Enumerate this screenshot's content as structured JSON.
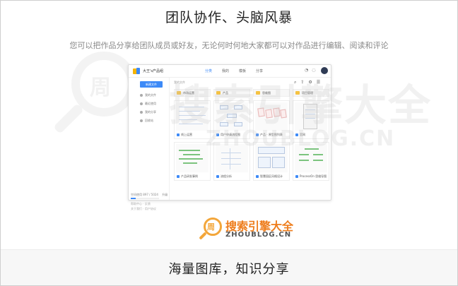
{
  "headline": "团队协作、头脑风暴",
  "subline": "您可以把作品分享给团队成员或好友，无论何时何地大家都可以对作品进行编辑、阅读和评论",
  "footer_title": "海量图库，知识分享",
  "watermark": {
    "circle_char": "周",
    "text": "搜索引擎大全",
    "sub": "ZHOUBLOG.CN"
  },
  "logo": {
    "circle_char": "周",
    "text": "搜索引擎大全",
    "sub": "ZHOUBLOG.CN",
    "color": "#ee7d1c"
  },
  "app": {
    "brand": "大王's产品组",
    "tabs": [
      {
        "label": "分类",
        "active": true
      },
      {
        "label": "我的",
        "active": false
      },
      {
        "label": "模板",
        "active": false
      },
      {
        "label": "分享",
        "active": false
      }
    ],
    "sidebar": {
      "new_button": "新建文件",
      "items": [
        {
          "label": "我的文件"
        },
        {
          "label": "最近使用"
        },
        {
          "label": "我的分享"
        },
        {
          "label": "回收站"
        }
      ],
      "storage": "空间使用 897 / 5024",
      "storage_unit": "升级",
      "storage_fraction": 0.18,
      "foot1": "帮助中心 · 反馈",
      "foot2": "关于我们 · 用户协议"
    },
    "breadcrumb": "我的文件",
    "folders": [
      {
        "label": "市场运营"
      },
      {
        "label": "产品"
      },
      {
        "label": "思维图"
      },
      {
        "label": "项目管理"
      }
    ],
    "cards": [
      {
        "label": "线上运营"
      },
      {
        "label": "用户申请流程图"
      },
      {
        "label": "产品 · 原型图列表"
      },
      {
        "label": "官网"
      },
      {
        "label": "产品研发事例"
      },
      {
        "label": "流程分析"
      },
      {
        "label": "智慧园区风格设计"
      },
      {
        "label": "ProcessOn 思维导图"
      }
    ],
    "accent": "#3d8af7"
  }
}
